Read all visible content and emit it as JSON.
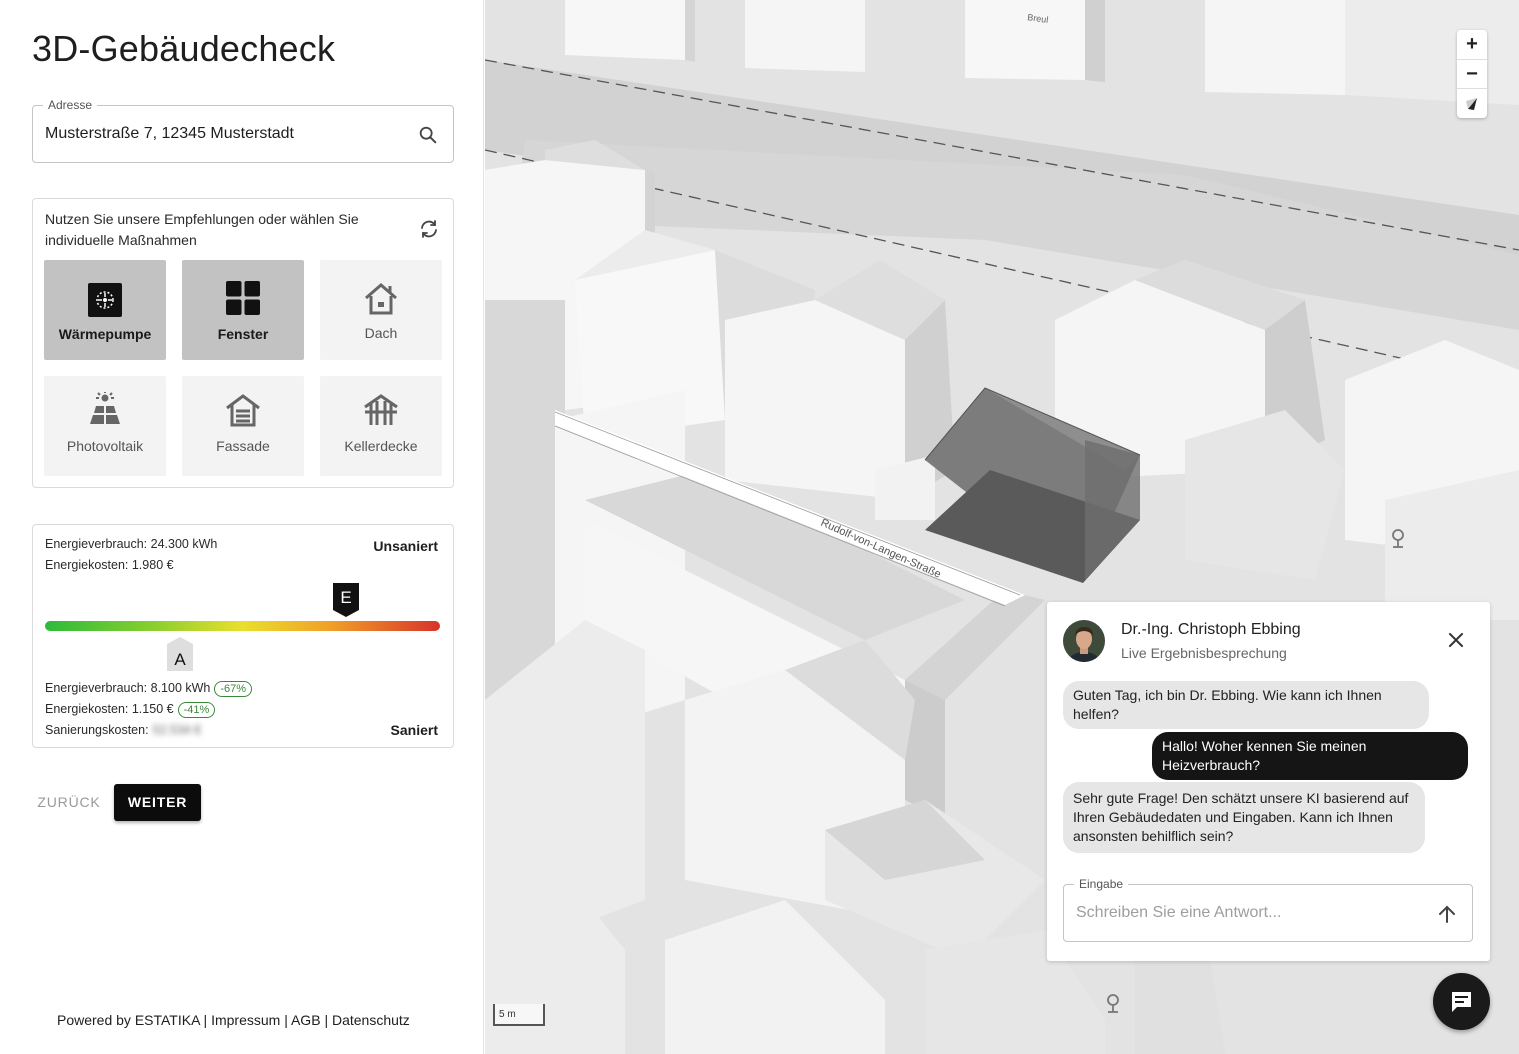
{
  "app": {
    "title": "3D-Gebäudecheck"
  },
  "address": {
    "legend": "Adresse",
    "value": "Musterstraße 7, 12345 Musterstadt"
  },
  "measures": {
    "hint": "Nutzen Sie unsere Empfehlungen oder wählen Sie individuelle Maßnahmen",
    "items": [
      {
        "label": "Wärmepumpe",
        "icon": "heat-pump-icon",
        "selected": true
      },
      {
        "label": "Fenster",
        "icon": "window-icon",
        "selected": true
      },
      {
        "label": "Dach",
        "icon": "roof-icon",
        "selected": false
      },
      {
        "label": "Photovoltaik",
        "icon": "solar-panel-icon",
        "selected": false
      },
      {
        "label": "Fassade",
        "icon": "facade-icon",
        "selected": false
      },
      {
        "label": "Kellerdecke",
        "icon": "basement-ceiling-icon",
        "selected": false
      }
    ]
  },
  "energy": {
    "before": {
      "consumption": "Energieverbrauch: 24.300 kWh",
      "costs": "Energiekosten: 1.980 €",
      "status": "Unsaniert",
      "class": "E"
    },
    "after": {
      "consumption": "Energieverbrauch: 8.100 kWh",
      "consumption_change": "-67%",
      "costs": "Energiekosten: 1.150 €",
      "costs_change": "-41%",
      "renovation_label": "Sanierungskosten:",
      "renovation_value": "52.534 €",
      "status": "Saniert",
      "class": "A"
    }
  },
  "nav": {
    "back": "ZURÜCK",
    "next": "WEITER"
  },
  "footer": {
    "brand": "Powered by ESTATIKA",
    "sep": "|",
    "imprint": "Impressum",
    "terms": "AGB",
    "privacy": "Datenschutz"
  },
  "map": {
    "street_label": "Rudolf-von-Langen-Straße",
    "place_label": "Breul",
    "scale": "5 m",
    "zoom_in": "+",
    "zoom_out": "−"
  },
  "chat": {
    "name": "Dr.-Ing. Christoph Ebbing",
    "subtitle": "Live Ergebnisbesprechung",
    "messages": [
      {
        "from": "expert",
        "text": "Guten Tag, ich bin Dr. Ebbing. Wie kann ich Ihnen helfen?"
      },
      {
        "from": "user",
        "text": "Hallo! Woher kennen Sie meinen Heizverbrauch?"
      },
      {
        "from": "expert",
        "text": "Sehr gute Frage! Den schätzt unsere KI basierend auf Ihren Gebäudedaten und Eingaben. Kann ich Ihnen ansonsten behilflich sein?"
      }
    ],
    "input_legend": "Eingabe",
    "input_placeholder": "Schreiben Sie eine Antwort..."
  },
  "colors": {
    "accent": "#0c0c0c",
    "selected_tile": "#c2c2c2",
    "success": "#3a8a3a"
  }
}
